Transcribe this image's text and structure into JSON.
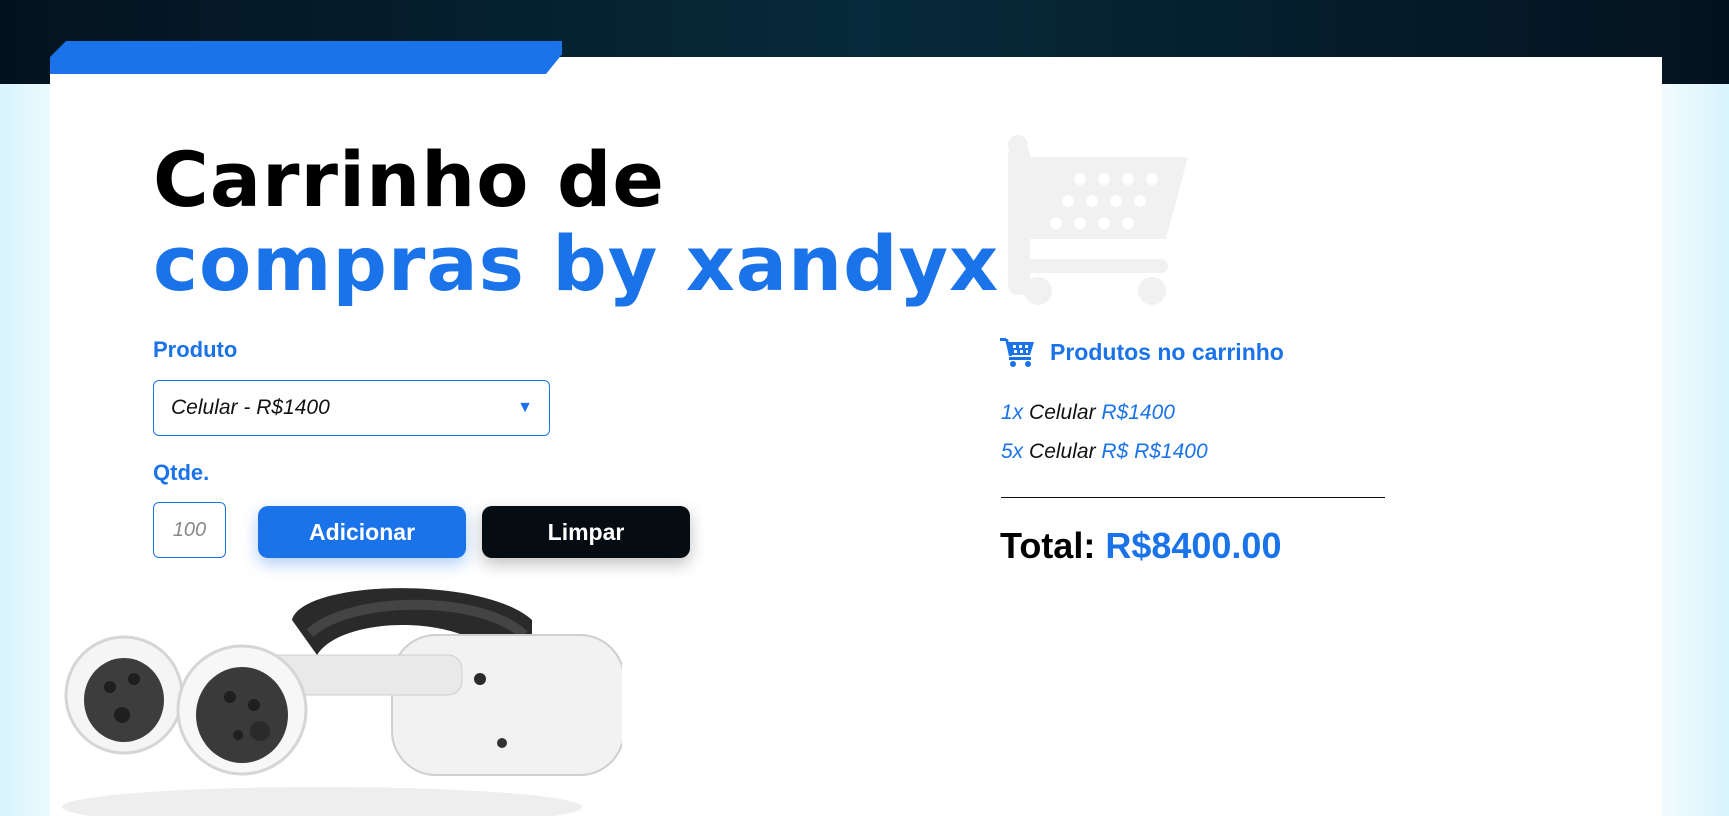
{
  "header": {
    "title_line1": "Carrinho de",
    "title_line2": "compras by xandyx"
  },
  "form": {
    "product_label": "Produto",
    "product_selected": "Celular - R$1400",
    "quantity_label": "Qtde.",
    "quantity_placeholder": "100",
    "add_button": "Adicionar",
    "clear_button": "Limpar"
  },
  "cart": {
    "heading": "Produtos no carrinho",
    "items": [
      {
        "qty": "1x",
        "name": "Celular",
        "price": "R$1400"
      },
      {
        "qty": "5x",
        "name": "Celular",
        "price": "R$ R$1400"
      }
    ],
    "total_label": "Total:",
    "total_value": "R$8400.00"
  },
  "icons": {
    "cart_watermark": "shopping-cart-icon",
    "cart_heading": "shopping-cart-icon",
    "select_caret": "caret-down-icon"
  },
  "colors": {
    "accent": "#1a73e8",
    "dark_button": "#050c12",
    "top_band": "#062a3b",
    "watermark": "#f1f1f1"
  }
}
